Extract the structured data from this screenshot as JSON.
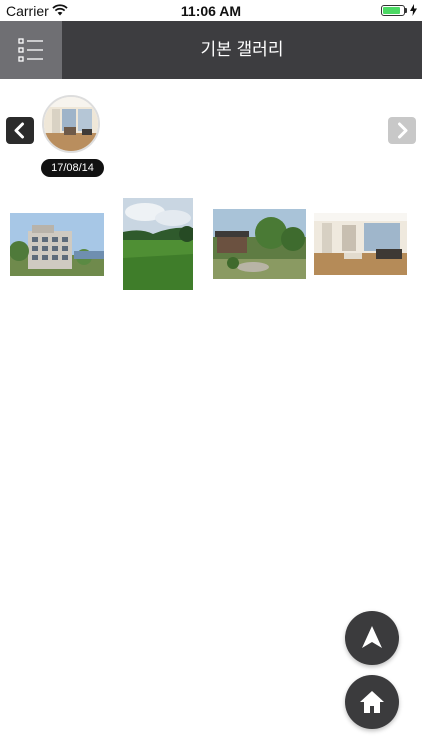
{
  "status_bar": {
    "carrier": "Carrier",
    "time": "11:06 AM",
    "battery_level": 0.85,
    "battery_color": "#4cd964"
  },
  "nav": {
    "title": "기본 갤러리",
    "menu_icon": "list-icon",
    "background": "#3d3d40"
  },
  "album": {
    "date": "17/08/14",
    "prev_icon": "chevron-left-icon",
    "next_icon": "chevron-right-icon"
  },
  "photos": [
    {
      "subject": "building exterior"
    },
    {
      "subject": "grass field"
    },
    {
      "subject": "garden"
    },
    {
      "subject": "living room interior"
    }
  ],
  "fabs": {
    "navigate_icon": "navigation-arrow-icon",
    "home_icon": "home-icon"
  }
}
